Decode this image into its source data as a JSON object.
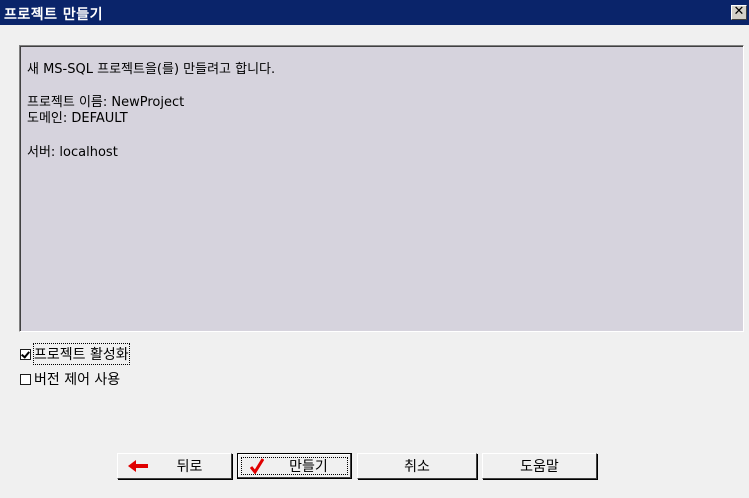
{
  "window": {
    "title": "프로젝트 만들기",
    "close_glyph": "✕"
  },
  "info": {
    "line1": "새 MS-SQL 프로젝트을(를) 만들려고 합니다.",
    "line2": "프로젝트 이름: NewProject",
    "line3": "도메인: DEFAULT",
    "line4": "서버: localhost"
  },
  "options": {
    "activate_project": {
      "label": "프로젝트 활성화",
      "checked": true
    },
    "version_control": {
      "label": "버전 제어 사용",
      "checked": false
    }
  },
  "buttons": {
    "back": "뒤로",
    "create": "만들기",
    "cancel": "취소",
    "help": "도움말"
  },
  "icons": {
    "back": "arrow-left-icon",
    "create": "checkmark-icon"
  },
  "colors": {
    "titlebar": "#0a246a",
    "panel": "#d6d3dd",
    "back_arrow": "#e00000",
    "check": "#e00000"
  }
}
